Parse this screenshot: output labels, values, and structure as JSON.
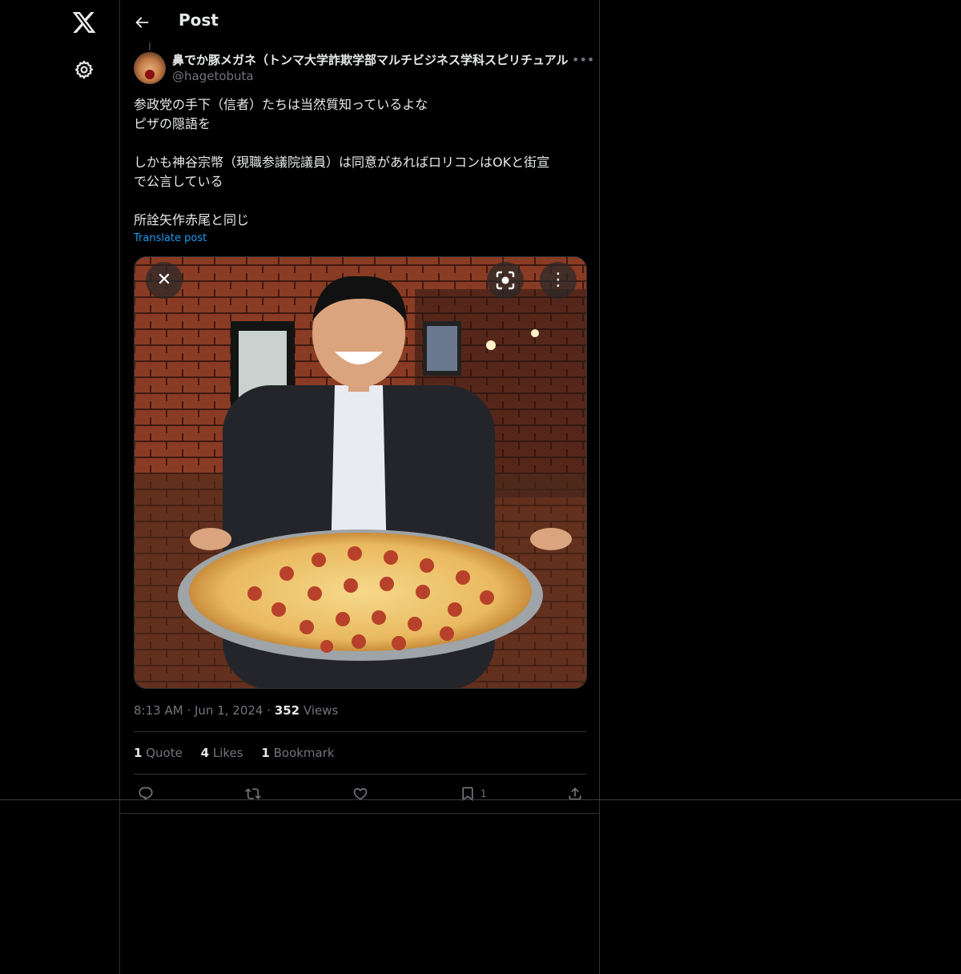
{
  "header": {
    "title": "Post"
  },
  "author": {
    "name": "鼻でか豚メガネ（トンマ大学詐欺学部マルチビジネス学科スピリチュアル",
    "handle": "@hagetobuta"
  },
  "post": {
    "lines": [
      "参政党の手下（信者）たちは当然質知っているよな",
      "ピザの隠語を",
      "",
      "しかも神谷宗幣（現職参議院議員）は同意があればロリコンはOKと街宣",
      "で公言している",
      "",
      "所詮矢作赤尾と同じ"
    ],
    "translate_label": "Translate post"
  },
  "media": {
    "overlay_close": "✕",
    "overlay_menu": "⋮"
  },
  "meta": {
    "time": "8:13 AM",
    "sep1": "·",
    "date": "Jun 1, 2024",
    "sep2": "·",
    "views_count": "352",
    "views_label": "Views"
  },
  "stats": {
    "quotes_count": "1",
    "quotes_label": "Quote",
    "likes_count": "4",
    "likes_label": "Likes",
    "bookmarks_count": "1",
    "bookmarks_label": "Bookmark"
  },
  "actions": {
    "bookmark_count": "1",
    "icons": [
      "reply-icon",
      "retweet-icon",
      "like-icon",
      "bookmark-icon",
      "share-icon"
    ]
  },
  "colors": {
    "background": "#000000",
    "text": "#e7e9ea",
    "muted": "#71767b",
    "link": "#1d9bf0",
    "border": "#2f3336"
  }
}
